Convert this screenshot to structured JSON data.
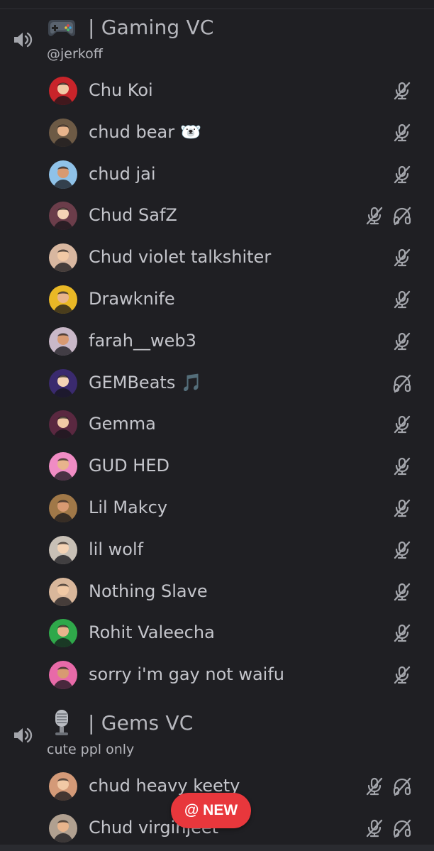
{
  "channels": [
    {
      "emoji_icon": "game-controller-icon",
      "title": "| Gaming VC",
      "subtitle": "@jerkoff",
      "members": [
        {
          "name": "Chu Koi",
          "emoji": "",
          "muted": true,
          "deafened": false,
          "avatar_color": "#c8242a"
        },
        {
          "name": "chud bear",
          "emoji": "🐻‍❄️",
          "muted": true,
          "deafened": false,
          "avatar_color": "#6d5a45"
        },
        {
          "name": "chud jai",
          "emoji": "",
          "muted": true,
          "deafened": false,
          "avatar_color": "#8fc2e8"
        },
        {
          "name": "Chud SafZ",
          "emoji": "",
          "muted": true,
          "deafened": true,
          "avatar_color": "#6b3d4a"
        },
        {
          "name": "Chud violet talkshiter",
          "emoji": "",
          "muted": true,
          "deafened": false,
          "avatar_color": "#d8b7a0"
        },
        {
          "name": "Drawknife",
          "emoji": "",
          "muted": true,
          "deafened": false,
          "avatar_color": "#e9b826"
        },
        {
          "name": "farah__web3",
          "emoji": "",
          "muted": true,
          "deafened": false,
          "avatar_color": "#c9b8c8"
        },
        {
          "name": "GEMBeats",
          "emoji": "🎵",
          "muted": false,
          "deafened": true,
          "avatar_color": "#3a2a6e"
        },
        {
          "name": "Gemma",
          "emoji": "",
          "muted": true,
          "deafened": false,
          "avatar_color": "#5a2840"
        },
        {
          "name": "GUD HED",
          "emoji": "",
          "muted": true,
          "deafened": false,
          "avatar_color": "#f08cc4"
        },
        {
          "name": "Lil Makcy",
          "emoji": "",
          "muted": true,
          "deafened": false,
          "avatar_color": "#a07848"
        },
        {
          "name": "lil wolf",
          "emoji": "",
          "muted": true,
          "deafened": false,
          "avatar_color": "#c8c0b6"
        },
        {
          "name": "Nothing Slave",
          "emoji": "",
          "muted": true,
          "deafened": false,
          "avatar_color": "#d9b79b"
        },
        {
          "name": "Rohit Valeecha",
          "emoji": "",
          "muted": true,
          "deafened": false,
          "avatar_color": "#2fa84a"
        },
        {
          "name": "sorry i'm gay not waifu",
          "emoji": "",
          "muted": true,
          "deafened": false,
          "avatar_color": "#e86aa8"
        }
      ]
    },
    {
      "emoji_icon": "microphone-icon",
      "title": "| Gems VC",
      "subtitle": "cute ppl only",
      "members": [
        {
          "name": "chud heavy keety",
          "emoji": "",
          "muted": true,
          "deafened": true,
          "avatar_color": "#d49a78"
        },
        {
          "name": "Chud virginjeet",
          "emoji": "",
          "muted": true,
          "deafened": true,
          "avatar_color": "#b0a090"
        }
      ]
    }
  ],
  "new_badge": {
    "label": "@ NEW",
    "color": "#e8373c"
  },
  "icons": {
    "speaker": "speaker-icon",
    "mute": "mic-muted-icon",
    "deafen": "headphones-deafened-icon"
  },
  "colors": {
    "background": "#1f1f23",
    "text": "#c4c5cb",
    "icon": "#a3a5ab"
  }
}
